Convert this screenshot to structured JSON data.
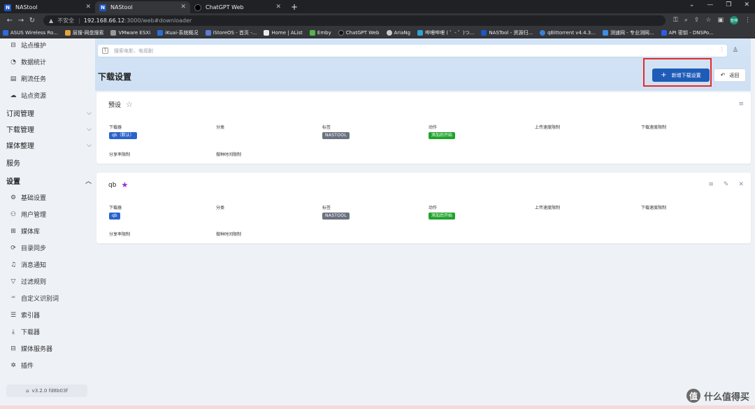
{
  "browser": {
    "tabs": [
      {
        "title": "NAStool",
        "icon": "N"
      },
      {
        "title": "NAStool",
        "icon": "N"
      },
      {
        "title": "ChatGPT Web",
        "icon": ""
      }
    ],
    "insecure_label": "不安全",
    "url_host": "192.168.66.12",
    "url_path": ":3000/web#downloader",
    "profile_badge": "暂停",
    "bookmarks": [
      {
        "label": "ASUS Wireless Ro...",
        "color": "#2d6ae0"
      },
      {
        "label": "层搜-网盘搜索",
        "color": "#e8a33b"
      },
      {
        "label": "VMware ESXi",
        "color": "#999999"
      },
      {
        "label": "iKuai-系统概况",
        "color": "#2a6fd6"
      },
      {
        "label": "iStoreOS - 首页 -...",
        "color": "#5b7dd8"
      },
      {
        "label": "Home | AList",
        "color": "#e8eaed"
      },
      {
        "label": "Emby",
        "color": "#52b54b"
      },
      {
        "label": "ChatGPT Web",
        "color": "#111111"
      },
      {
        "label": "AriaNg",
        "color": "#c9c9c9"
      },
      {
        "label": "哔哩哔哩 ( ゜- ゜)つ...",
        "color": "#2fa3d6"
      },
      {
        "label": "NASTool - 资源归...",
        "color": "#1e56c4"
      },
      {
        "label": "qBittorrent v4.4.3...",
        "color": "#3b7fd9"
      },
      {
        "label": "测速网 - 专业测网...",
        "color": "#3a8ee6"
      },
      {
        "label": "API 密钥 - DNSPo...",
        "color": "#2e5be6"
      }
    ]
  },
  "sidebar": {
    "items": [
      {
        "label": "站点维护",
        "icon": "server-icon"
      },
      {
        "label": "数据统计",
        "icon": "chart-pie-icon"
      },
      {
        "label": "刷流任务",
        "icon": "clipboard-icon"
      },
      {
        "label": "站点资源",
        "icon": "cloud-icon"
      }
    ],
    "groups": [
      {
        "label": "订阅管理"
      },
      {
        "label": "下载管理"
      },
      {
        "label": "媒体整理"
      },
      {
        "label": "服务"
      },
      {
        "label": "设置"
      }
    ],
    "settings_items": [
      {
        "label": "基础设置",
        "icon": "gear-icon"
      },
      {
        "label": "用户管理",
        "icon": "users-icon"
      },
      {
        "label": "媒体库",
        "icon": "library-icon"
      },
      {
        "label": "目录同步",
        "icon": "refresh-icon"
      },
      {
        "label": "消息通知",
        "icon": "bell-icon"
      },
      {
        "label": "过滤规则",
        "icon": "filter-icon"
      },
      {
        "label": "自定义识别词",
        "icon": "spell-check-icon"
      },
      {
        "label": "索引器",
        "icon": "list-search-icon"
      },
      {
        "label": "下载器",
        "icon": "download-icon"
      },
      {
        "label": "媒体服务器",
        "icon": "server-icon"
      },
      {
        "label": "插件",
        "icon": "puzzle-icon"
      }
    ],
    "version": "v3.2.0 fd8b03f"
  },
  "main": {
    "search_placeholder": "搜索电影、电视剧",
    "page_title": "下载设置",
    "add_button": "新增下载设置",
    "back_button": "返回",
    "cards": [
      {
        "name": "预设",
        "starred": false,
        "fields": {
          "downloader_label": "下载器",
          "downloader_value": "qb（默认）",
          "category_label": "分类",
          "tag_label": "标签",
          "tag_value": "NASTOOL",
          "action_label": "动作",
          "action_value": "添加后开始",
          "upload_limit_label": "上传速度限制",
          "download_limit_label": "下载速度限制",
          "ratio_label": "分享率限制",
          "seedtime_label": "做种时间限制"
        }
      },
      {
        "name": "qb",
        "starred": true,
        "fields": {
          "downloader_label": "下载器",
          "downloader_value": "qb",
          "category_label": "分类",
          "tag_label": "标签",
          "tag_value": "NASTOOL",
          "action_label": "动作",
          "action_value": "添加后开始",
          "upload_limit_label": "上传速度限制",
          "download_limit_label": "下载速度限制",
          "ratio_label": "分享率限制",
          "seedtime_label": "做种时间限制"
        }
      }
    ]
  },
  "watermark": "什么值得买",
  "colors": {
    "accent": "#1e5cb8",
    "highlight_box": "#e52b2b",
    "tag_blue": "#2a63c9",
    "tag_gray": "#6b7280",
    "tag_green": "#21a32b",
    "star_active": "#9b27d6"
  }
}
